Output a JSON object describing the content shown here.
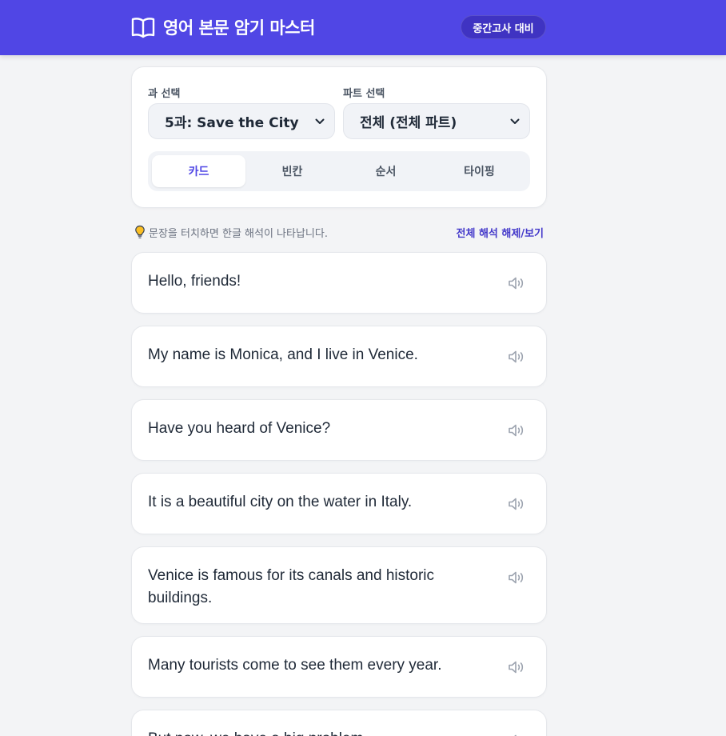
{
  "header": {
    "title": "영어 본문 암기 마스터",
    "icon": "open-book-icon",
    "badge": "중간고사 대비",
    "background_color": "#5046e5"
  },
  "controls": {
    "lesson": {
      "label": "과 선택",
      "value": "5과: Save the City"
    },
    "part": {
      "label": "파트 선택",
      "value": "전체 (전체 파트)"
    },
    "tabs": [
      {
        "label": "카드",
        "active": true
      },
      {
        "label": "빈칸",
        "active": false
      },
      {
        "label": "순서",
        "active": false
      },
      {
        "label": "타이핑",
        "active": false
      }
    ]
  },
  "hint": {
    "icon": "lightbulb-icon",
    "text": "문장을 터치하면 한글 해석이 나타납니다.",
    "toggle_all": "전체 해석 해제/보기"
  },
  "sentences": [
    {
      "text": "Hello, friends!"
    },
    {
      "text": "My name is Monica, and I live in Venice."
    },
    {
      "text": "Have you heard of Venice?"
    },
    {
      "text": "It is a beautiful city on the water in Italy."
    },
    {
      "text": "Venice is famous for its canals and historic buildings."
    },
    {
      "text": "Many tourists come to see them every year."
    },
    {
      "text": "But now, we have a big problem."
    }
  ],
  "accent_color": "#4f46e5"
}
